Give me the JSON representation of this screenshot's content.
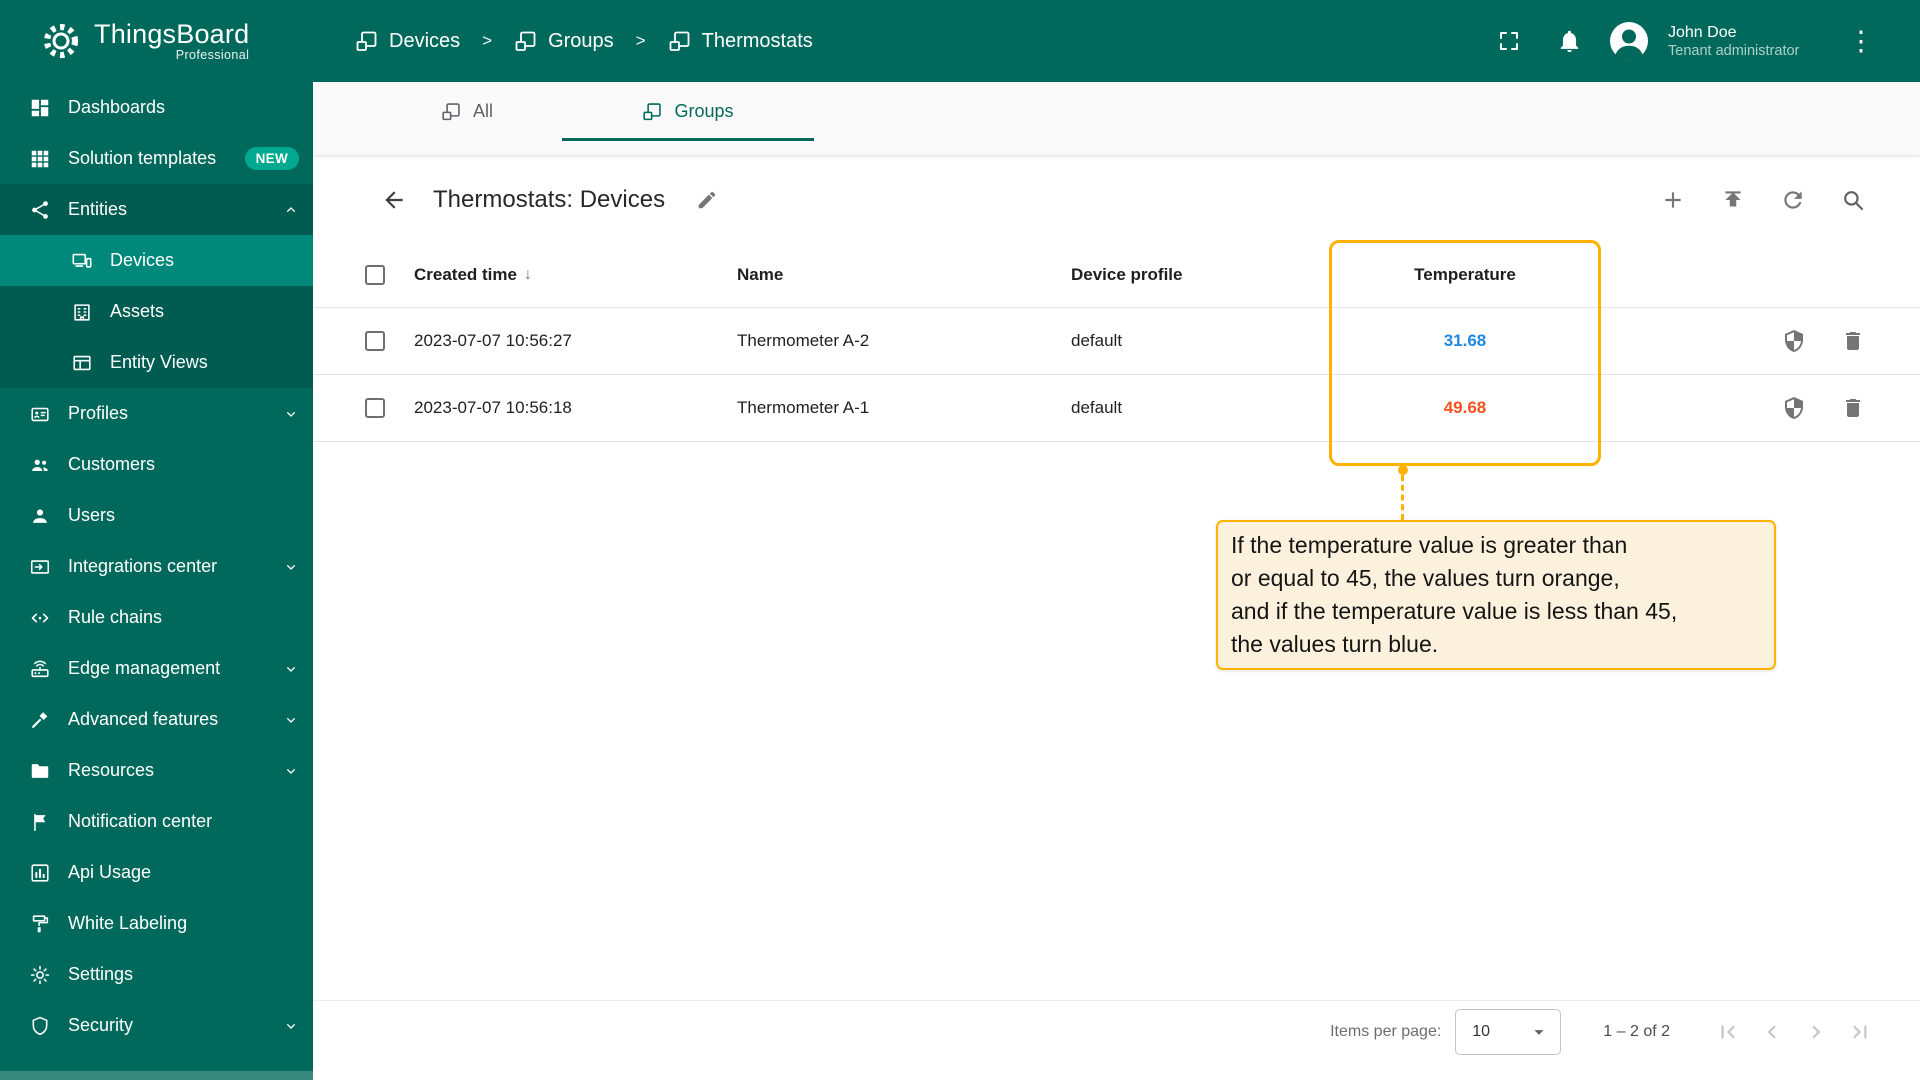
{
  "app": {
    "name": "ThingsBoard",
    "edition": "Professional"
  },
  "header": {
    "breadcrumb": [
      {
        "label": "Devices",
        "icon": "device-group"
      },
      {
        "label": "Groups",
        "icon": "device-group"
      },
      {
        "label": "Thermostats",
        "icon": "device-group"
      }
    ],
    "action_icons": [
      "fullscreen-icon",
      "notifications-bell-icon",
      "kebab-menu-icon"
    ],
    "user": {
      "name": "John Doe",
      "role": "Tenant administrator",
      "avatar_icon": "account-circle-icon"
    }
  },
  "sidebar": {
    "items": [
      {
        "label": "Dashboards",
        "icon": "dashboards-icon"
      },
      {
        "label": "Solution templates",
        "icon": "solution-templates-icon",
        "badge": "NEW"
      },
      {
        "label": "Entities",
        "icon": "entities-icon",
        "expanded": true
      },
      {
        "label": "Devices",
        "icon": "devices-icon",
        "child": true,
        "selected": true
      },
      {
        "label": "Assets",
        "icon": "assets-icon",
        "child": true
      },
      {
        "label": "Entity Views",
        "icon": "entity-views-icon",
        "child": true
      },
      {
        "label": "Profiles",
        "icon": "profiles-icon",
        "collapsible": true
      },
      {
        "label": "Customers",
        "icon": "customers-icon"
      },
      {
        "label": "Users",
        "icon": "users-icon"
      },
      {
        "label": "Integrations center",
        "icon": "integrations-center-icon",
        "collapsible": true
      },
      {
        "label": "Rule chains",
        "icon": "rule-chains-icon"
      },
      {
        "label": "Edge management",
        "icon": "edge-management-icon",
        "collapsible": true
      },
      {
        "label": "Advanced features",
        "icon": "advanced-features-icon",
        "collapsible": true
      },
      {
        "label": "Resources",
        "icon": "resources-icon",
        "collapsible": true
      },
      {
        "label": "Notification center",
        "icon": "notification-center-icon"
      },
      {
        "label": "Api Usage",
        "icon": "api-usage-icon"
      },
      {
        "label": "White Labeling",
        "icon": "white-labeling-icon"
      },
      {
        "label": "Settings",
        "icon": "settings-icon"
      },
      {
        "label": "Security",
        "icon": "security-icon",
        "collapsible": true
      }
    ]
  },
  "tabs": [
    {
      "label": "All",
      "icon": "device-group"
    },
    {
      "label": "Groups",
      "icon": "device-group",
      "active": true
    }
  ],
  "toolbar": {
    "title": "Thermostats: Devices",
    "edit_icon": "pencil-icon",
    "action_icons": [
      "add-icon",
      "upload-icon",
      "refresh-icon",
      "search-icon"
    ]
  },
  "table": {
    "columns": {
      "created": "Created time",
      "name": "Name",
      "profile": "Device profile",
      "temperature": "Temperature"
    },
    "sort": {
      "column": "Created time",
      "direction": "desc"
    },
    "rows": [
      {
        "created": "2023-07-07 10:56:27",
        "name": "Thermometer A-2",
        "profile": "default",
        "temperature": "31.68",
        "temperature_color": "#1E88E5"
      },
      {
        "created": "2023-07-07 10:56:18",
        "name": "Thermometer A-1",
        "profile": "default",
        "temperature": "49.68",
        "temperature_color": "#F4511E"
      }
    ],
    "row_action_icons": [
      "shield-icon",
      "trash-icon"
    ]
  },
  "annotation": {
    "lines": [
      "If the temperature value is greater than",
      "or equal to 45, the values turn orange,",
      "and if the temperature value is less than 45,",
      "the values turn blue."
    ],
    "border_color": "#FFB300",
    "background": "#FBF1DC"
  },
  "pagination": {
    "items_per_page_label": "Items per page:",
    "page_size": "10",
    "range": "1 – 2 of 2"
  },
  "colors": {
    "header": "#00695C",
    "sidebar_selected": "#00897B",
    "accent": "#00695C",
    "temp_blue": "#1E88E5",
    "temp_orange": "#F4511E",
    "highlight": "#FFB300"
  }
}
